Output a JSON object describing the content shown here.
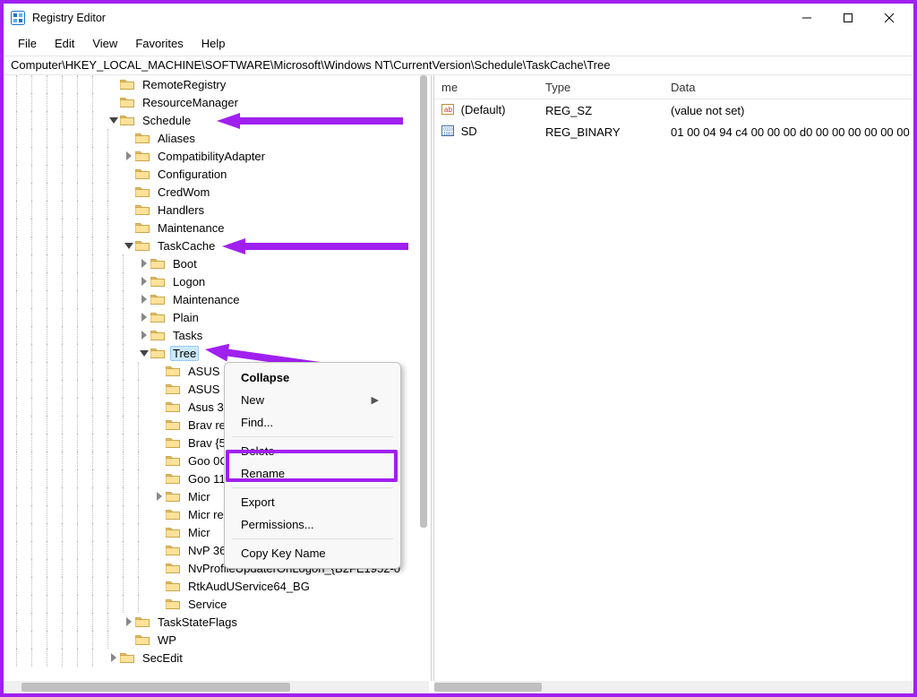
{
  "window": {
    "title": "Registry Editor"
  },
  "menu": {
    "file": "File",
    "edit": "Edit",
    "view": "View",
    "favorites": "Favorites",
    "help": "Help"
  },
  "address": "Computer\\HKEY_LOCAL_MACHINE\\SOFTWARE\\Microsoft\\Windows NT\\CurrentVersion\\Schedule\\TaskCache\\Tree",
  "right": {
    "headers": {
      "name": "me",
      "type": "Type",
      "data": "Data"
    },
    "rows": [
      {
        "name": "(Default)",
        "type": "REG_SZ",
        "data": "(value not set)"
      },
      {
        "name": "SD",
        "type": "REG_BINARY",
        "data": "01 00 04 94 c4 00 00 00 d0 00 00 00 00 00 00 00"
      }
    ]
  },
  "tree": [
    {
      "depth": 13,
      "arrow": "",
      "label": "RemoteRegistry"
    },
    {
      "depth": 13,
      "arrow": "",
      "label": "ResourceManager"
    },
    {
      "depth": 13,
      "arrow": "down",
      "label": "Schedule"
    },
    {
      "depth": 14,
      "arrow": "",
      "label": "Aliases"
    },
    {
      "depth": 14,
      "arrow": "right",
      "label": "CompatibilityAdapter"
    },
    {
      "depth": 14,
      "arrow": "",
      "label": "Configuration"
    },
    {
      "depth": 14,
      "arrow": "",
      "label": "CredWom"
    },
    {
      "depth": 14,
      "arrow": "",
      "label": "Handlers"
    },
    {
      "depth": 14,
      "arrow": "",
      "label": "Maintenance"
    },
    {
      "depth": 14,
      "arrow": "down",
      "label": "TaskCache"
    },
    {
      "depth": 15,
      "arrow": "right",
      "label": "Boot"
    },
    {
      "depth": 15,
      "arrow": "right",
      "label": "Logon"
    },
    {
      "depth": 15,
      "arrow": "right",
      "label": "Maintenance"
    },
    {
      "depth": 15,
      "arrow": "right",
      "label": "Plain"
    },
    {
      "depth": 15,
      "arrow": "right",
      "label": "Tasks"
    },
    {
      "depth": 15,
      "arrow": "down",
      "label": "Tree",
      "selected": true
    },
    {
      "depth": 16,
      "arrow": "",
      "label": "ASUS"
    },
    {
      "depth": 16,
      "arrow": "",
      "label": "ASUS"
    },
    {
      "depth": 16,
      "arrow": "",
      "label": "Asus                                          3F2"
    },
    {
      "depth": 16,
      "arrow": "",
      "label": "Brav                                           re{"
    },
    {
      "depth": 16,
      "arrow": "",
      "label": "Brav                                          {58"
    },
    {
      "depth": 16,
      "arrow": "",
      "label": "Goo                                         0C6"
    },
    {
      "depth": 16,
      "arrow": "",
      "label": "Goo                                           11"
    },
    {
      "depth": 16,
      "arrow": "right",
      "label": "Micr"
    },
    {
      "depth": 16,
      "arrow": "",
      "label": "Micr                                          ret"
    },
    {
      "depth": 16,
      "arrow": "",
      "label": "Micr"
    },
    {
      "depth": 16,
      "arrow": "",
      "label": "NvP                                           36"
    },
    {
      "depth": 16,
      "arrow": "",
      "label": "NvProfileUpdaterOnLogon_{B2FE1952-0"
    },
    {
      "depth": 16,
      "arrow": "",
      "label": "RtkAudUService64_BG"
    },
    {
      "depth": 16,
      "arrow": "",
      "label": "Service"
    },
    {
      "depth": 14,
      "arrow": "right",
      "label": "TaskStateFlags"
    },
    {
      "depth": 14,
      "arrow": "",
      "label": "WP"
    },
    {
      "depth": 13,
      "arrow": "right",
      "label": "SecEdit"
    }
  ],
  "contextMenu": {
    "collapse": "Collapse",
    "new": "New",
    "find": "Find...",
    "delete": "Delete",
    "rename": "Rename",
    "export": "Export",
    "permissions": "Permissions...",
    "copyKeyName": "Copy Key Name"
  }
}
